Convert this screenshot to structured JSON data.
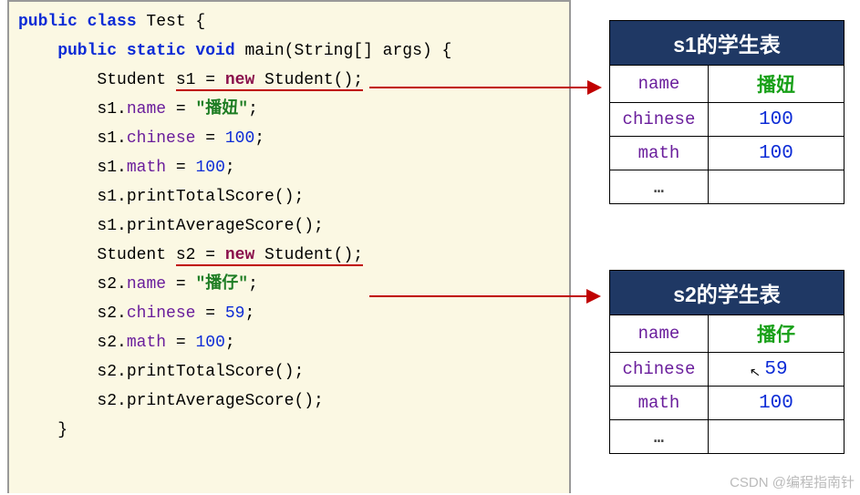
{
  "code": {
    "l01a": "public class",
    "l01b": " Test {",
    "l02a": "    public static void",
    "l02b": " main(String[] args) {",
    "l03a": "        Student ",
    "l03s1": "s1",
    "l03eq": " = ",
    "l03new": "new",
    "l03rest": " Student();",
    "l04a": "        s1",
    "l04dot": ".",
    "l04fld": "name",
    "l04eq": " = ",
    "l04str": "\"播妞\"",
    "l04semi": ";",
    "l05a": "        s1",
    "l05dot": ".",
    "l05fld": "chinese",
    "l05eq": " = ",
    "l05num": "100",
    "l05semi": ";",
    "l06a": "        s1",
    "l06dot": ".",
    "l06fld": "math",
    "l06eq": " = ",
    "l06num": "100",
    "l06semi": ";",
    "l07": "        s1.printTotalScore();",
    "l08": "        s1.printAverageScore();",
    "l09": "",
    "l10a": "        Student ",
    "l10s2": "s2",
    "l10eq": " = ",
    "l10new": "new",
    "l10rest": " Student();",
    "l11a": "        s2",
    "l11dot": ".",
    "l11fld": "name",
    "l11eq": " = ",
    "l11str": "\"播仔\"",
    "l11semi": ";",
    "l12a": "        s2",
    "l12dot": ".",
    "l12fld": "chinese",
    "l12eq": " = ",
    "l12num": "59",
    "l12semi": ";",
    "l13a": "        s2",
    "l13dot": ".",
    "l13fld": "math",
    "l13eq": " = ",
    "l13num": "100",
    "l13semi": ";",
    "l14": "        s2.printTotalScore();",
    "l15": "        s2.printAverageScore();",
    "l16": "    }"
  },
  "table1": {
    "title": "s1的学生表",
    "rows": [
      {
        "k": "name",
        "v": "播妞",
        "green": true
      },
      {
        "k": "chinese",
        "v": "100"
      },
      {
        "k": "math",
        "v": "100"
      }
    ],
    "dots": "…"
  },
  "table2": {
    "title": "s2的学生表",
    "rows": [
      {
        "k": "name",
        "v": "播仔",
        "green": true
      },
      {
        "k": "chinese",
        "v": "59"
      },
      {
        "k": "math",
        "v": "100"
      }
    ],
    "dots": "…"
  },
  "watermark": "CSDN @编程指南针"
}
